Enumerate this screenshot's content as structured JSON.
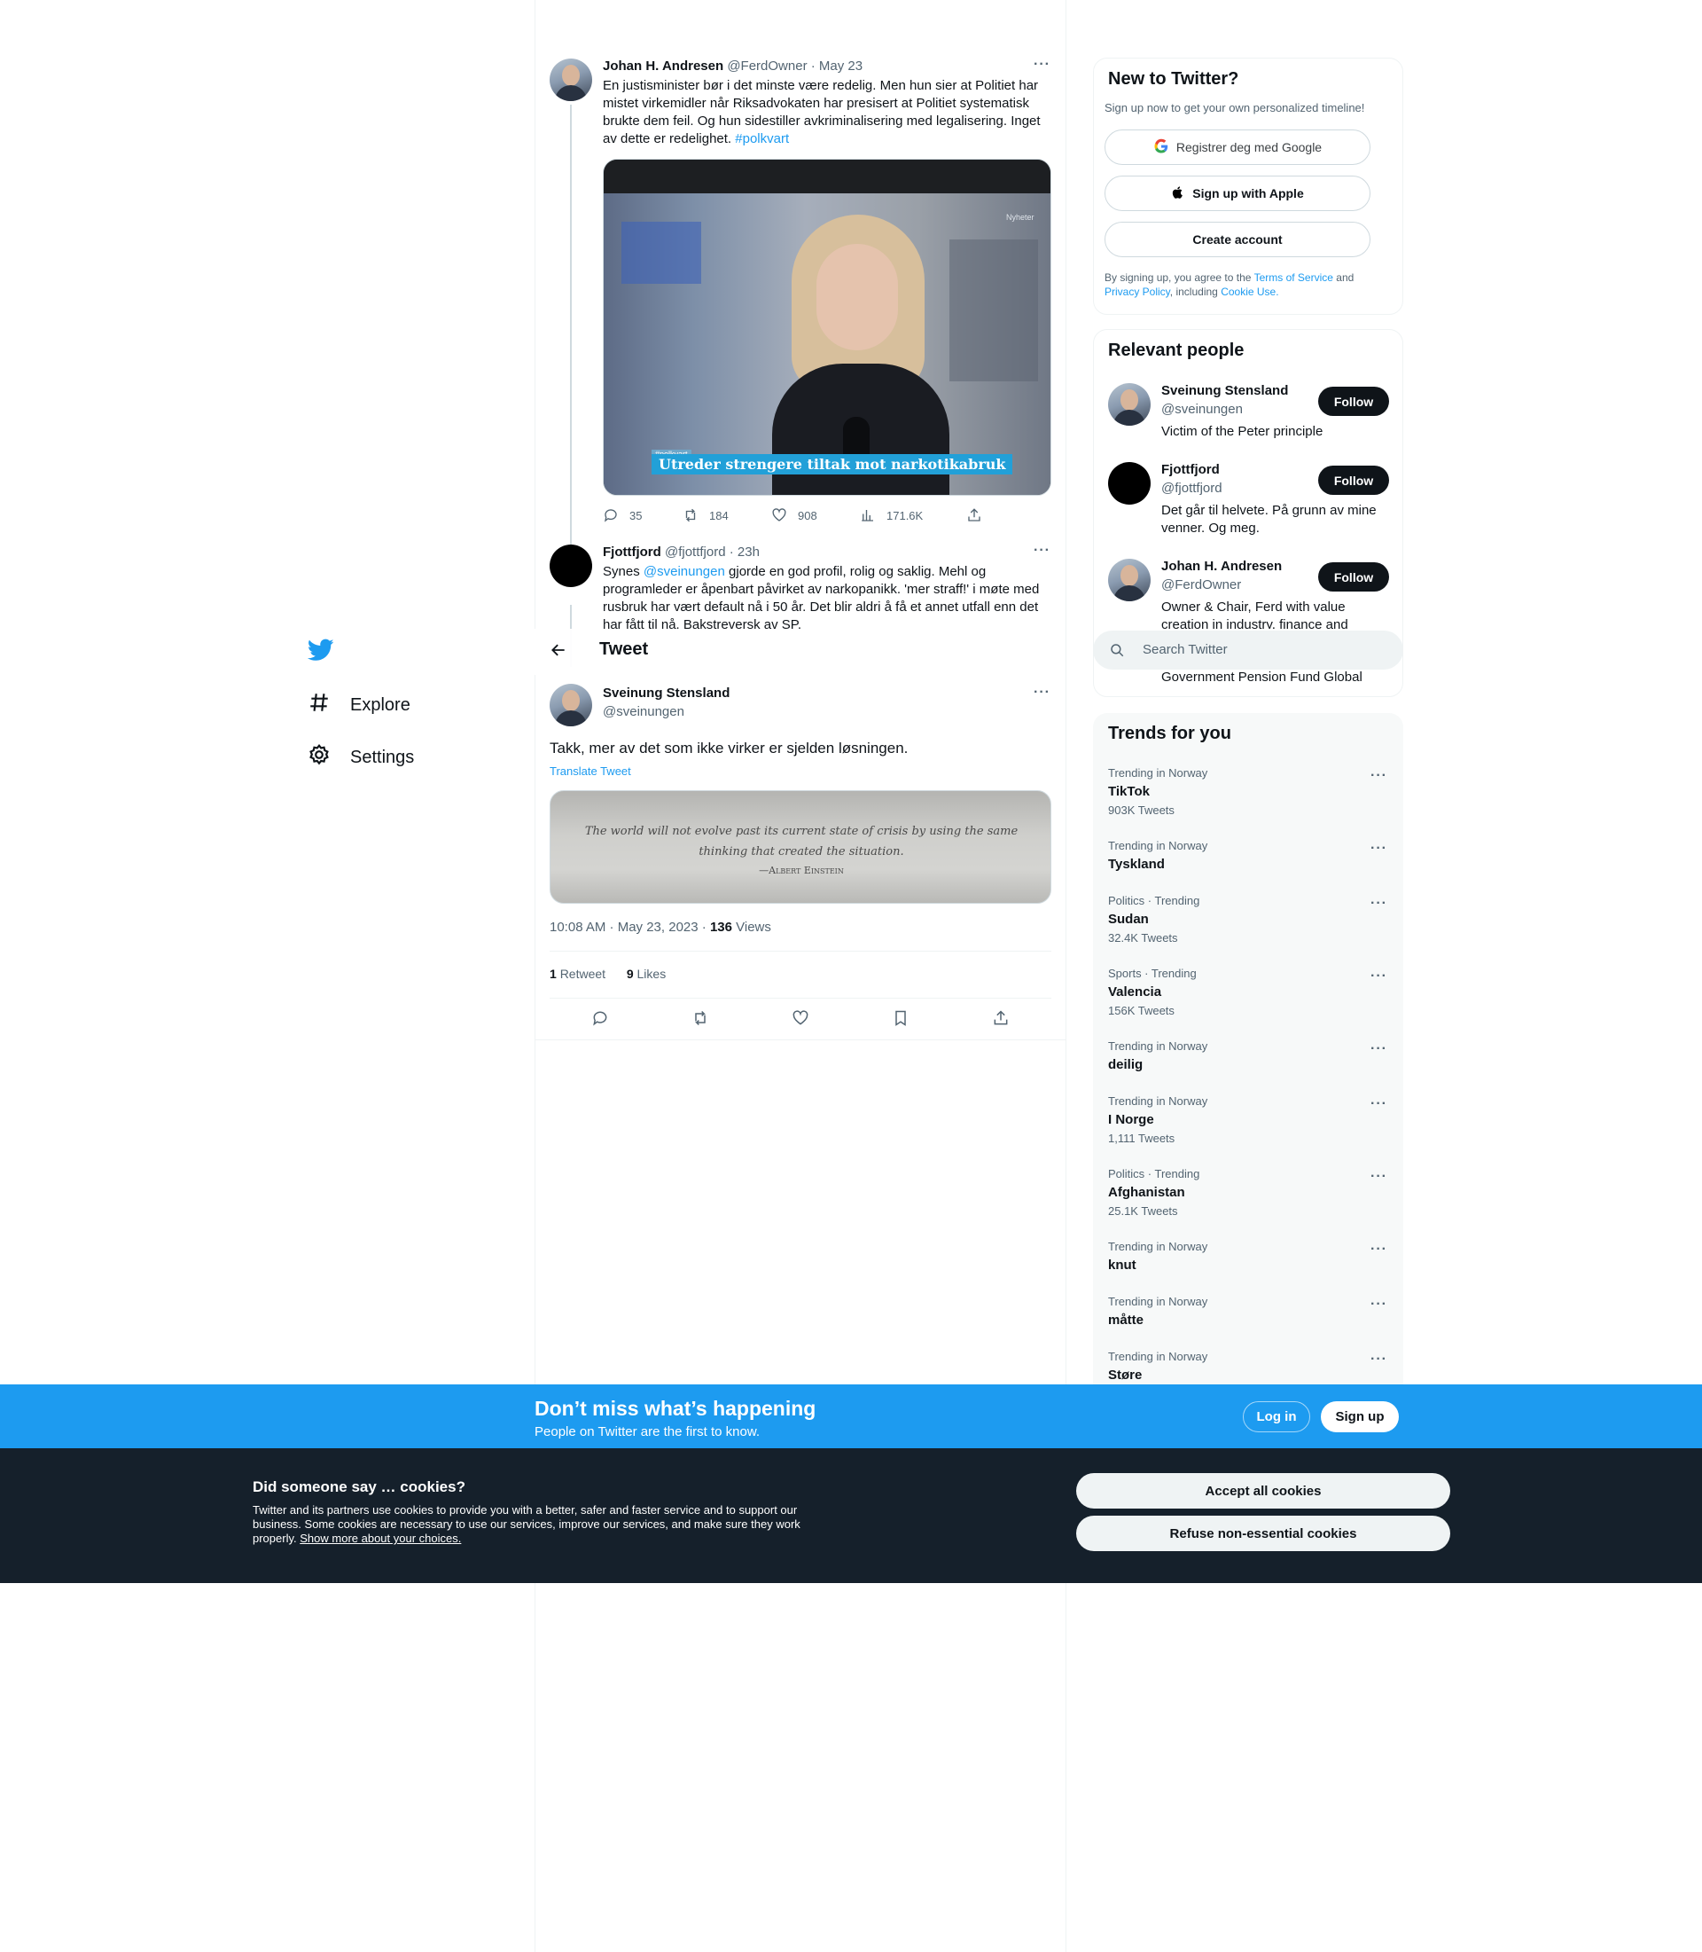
{
  "nav": {
    "items": [
      {
        "label": "Explore",
        "icon": "hash-icon"
      },
      {
        "label": "Settings",
        "icon": "gear-icon"
      }
    ]
  },
  "header": {
    "title": "Tweet"
  },
  "thread": [
    {
      "name": "Johan H. Andresen",
      "handle": "@FerdOwner",
      "time": "· May 23",
      "text": "En justisminister bør i det minste være redelig. Men hun sier at Politiet har mistet virkemidler når Riksadvokaten har presisert at Politiet systematisk brukte dem feil. Og hun sidestiller avkriminalisering med legalisering. Inget av dette er redelighet.",
      "hashtag": "#polkvart",
      "media": {
        "tag": "#polkvart",
        "headline": "Utreder strengere tiltak mot narkotikabruk",
        "corner": "Nyheter"
      },
      "stats": {
        "replies": "35",
        "retweets": "184",
        "likes": "908",
        "views": "171.6K"
      }
    },
    {
      "name": "Fjottfjord",
      "handle": "@fjottfjord",
      "time": "· 23h",
      "text_pre": "Synes",
      "mention": "@sveinungen",
      "text_post": "gjorde en god profil, rolig og saklig. Mehl og programleder er åpenbart påvirket av narkopanikk. 'mer straff!' i møte med rusbruk har vært default nå i 50 år. Det blir aldri å få et annet utfall enn det har fått til nå. Bakstreversk av SP."
    }
  ],
  "main_tweet": {
    "name": "Sveinung Stensland",
    "handle": "@sveinungen",
    "text": "Takk, mer av det som ikke virker er sjelden løsningen.",
    "translate": "Translate Tweet",
    "quote_image": {
      "line1": "The world will not evolve past its current state of crisis by using the same",
      "line2": "thinking that created the situation.",
      "line3": "—Albert Einstein"
    },
    "timestamp": "10:08 AM · May 23, 2023 ·",
    "views_count": "136",
    "views_label": "Views",
    "retweets_count": "1",
    "retweets_label": "Retweet",
    "likes_count": "9",
    "likes_label": "Likes"
  },
  "signup": {
    "title": "New to Twitter?",
    "subtitle": "Sign up now to get your own personalized timeline!",
    "google": "Registrer deg med Google",
    "apple": "Sign up with Apple",
    "create": "Create account",
    "legal_1": "By signing up, you agree to the",
    "terms": "Terms of Service",
    "and": "and",
    "privacy": "Privacy Policy",
    "including": ", including",
    "cookie": "Cookie Use."
  },
  "relevant": {
    "title": "Relevant people",
    "follow_label": "Follow",
    "people": [
      {
        "name": "Sveinung Stensland",
        "handle": "@sveinungen",
        "bio": "Victim of the Peter principle"
      },
      {
        "name": "Fjottfjord",
        "handle": "@fjottfjord",
        "bio": "Det går til helvete. På grunn av mine venner. Og meg."
      },
      {
        "name": "Johan H. Andresen",
        "handle": "@FerdOwner",
        "bio": "Owner & Chair, Ferd with value creation in industry, finance and"
      }
    ],
    "overflow_text": "Government Pension Fund Global"
  },
  "search": {
    "placeholder": "Search Twitter"
  },
  "trends": {
    "title": "Trends for you",
    "items": [
      {
        "meta": "Trending in Norway",
        "name": "TikTok",
        "count": "903K Tweets"
      },
      {
        "meta": "Trending in Norway",
        "name": "Tyskland",
        "count": ""
      },
      {
        "meta": "Politics · Trending",
        "name": "Sudan",
        "count": "32.4K Tweets"
      },
      {
        "meta": "Sports · Trending",
        "name": "Valencia",
        "count": "156K Tweets"
      },
      {
        "meta": "Trending in Norway",
        "name": "deilig",
        "count": ""
      },
      {
        "meta": "Trending in Norway",
        "name": "I Norge",
        "count": "1,111 Tweets"
      },
      {
        "meta": "Politics · Trending",
        "name": "Afghanistan",
        "count": "25.1K Tweets"
      },
      {
        "meta": "Trending in Norway",
        "name": "knut",
        "count": ""
      },
      {
        "meta": "Trending in Norway",
        "name": "måtte",
        "count": ""
      },
      {
        "meta": "Trending in Norway",
        "name": "Støre",
        "count": ""
      }
    ]
  },
  "banner": {
    "title": "Don’t miss what’s happening",
    "subtitle": "People on Twitter are the first to know.",
    "login": "Log in",
    "signup": "Sign up"
  },
  "cookies": {
    "title": "Did someone say … cookies?",
    "body": "Twitter and its partners use cookies to provide you with a better, safer and faster service and to support our business. Some cookies are necessary to use our services, improve our services, and make sure they work properly.",
    "more": "Show more about your choices.",
    "accept": "Accept all cookies",
    "refuse": "Refuse non-essential cookies"
  },
  "colors": {
    "accent": "#1d9bf0",
    "text": "#0f1419",
    "muted": "#536471",
    "cookie_bg": "#15202b"
  }
}
